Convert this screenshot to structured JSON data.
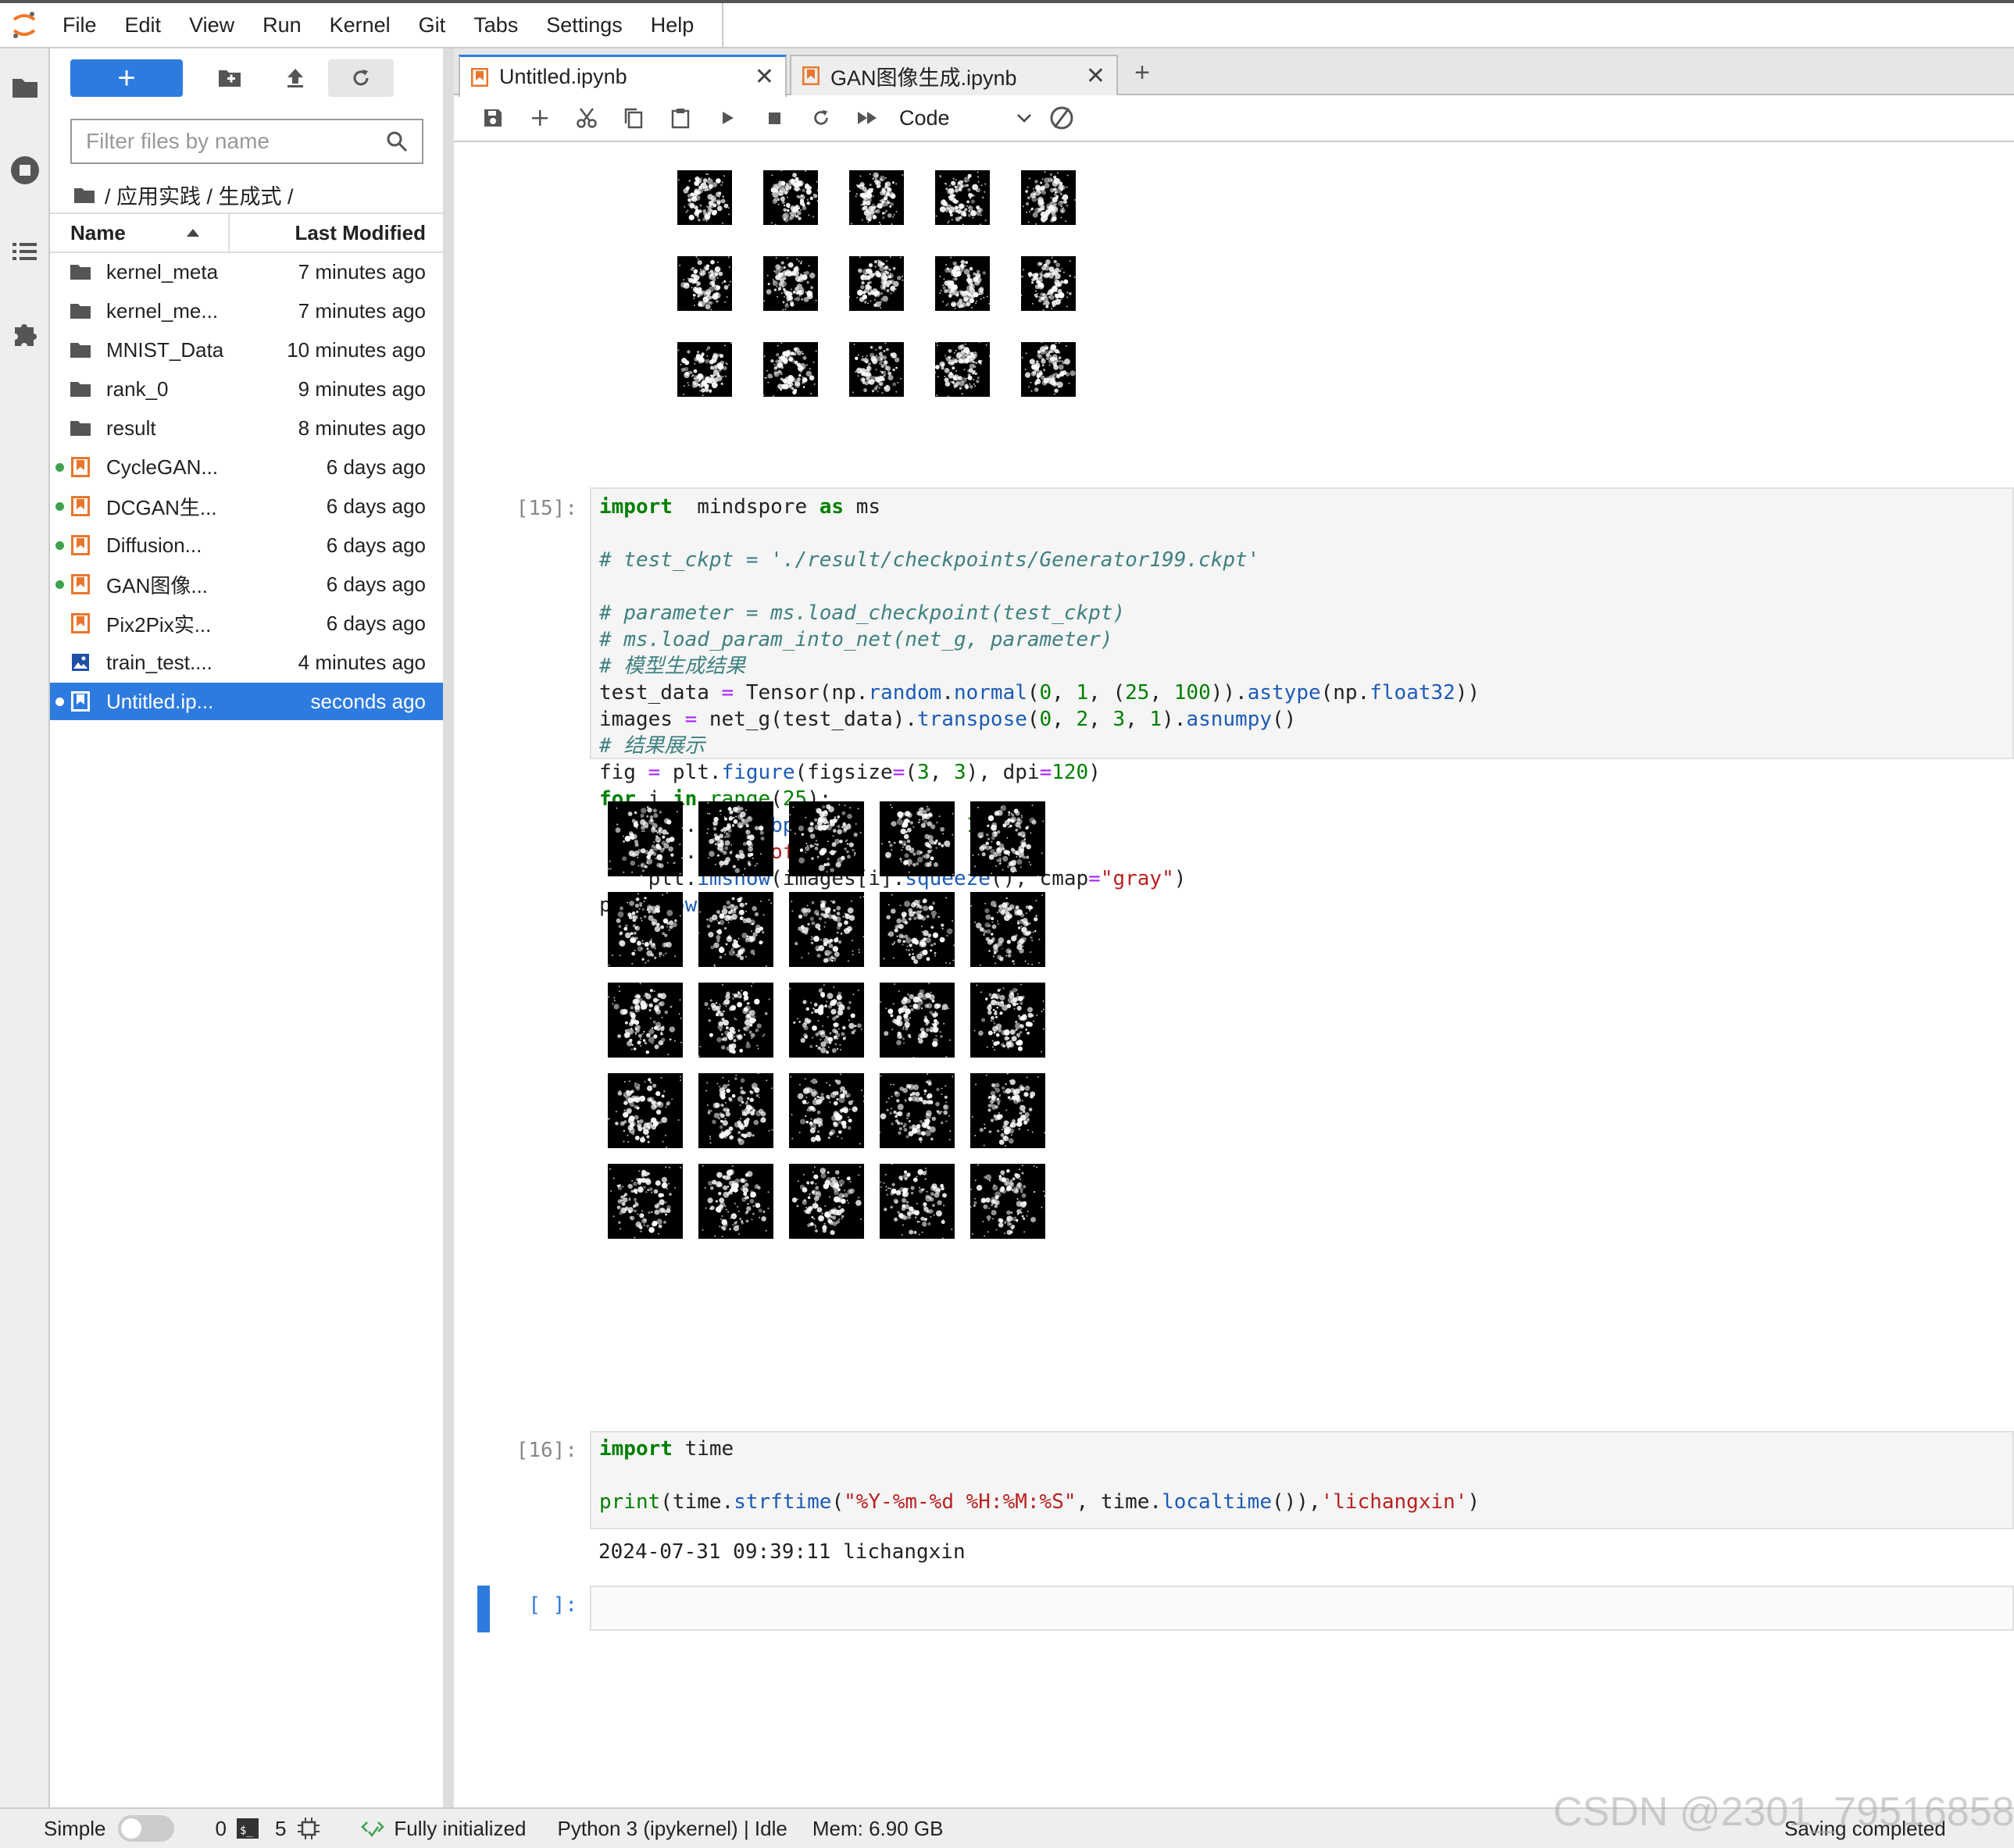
{
  "menu": {
    "items": [
      "File",
      "Edit",
      "View",
      "Run",
      "Kernel",
      "Git",
      "Tabs",
      "Settings",
      "Help"
    ]
  },
  "filebrowser": {
    "filter_placeholder": "Filter files by name",
    "breadcrumb": "/ 应用实践 / 生成式 /",
    "col_name": "Name",
    "col_modified": "Last Modified",
    "files": [
      {
        "name": "kernel_meta",
        "modified": "7 minutes ago",
        "type": "folder",
        "running": false
      },
      {
        "name": "kernel_me...",
        "modified": "7 minutes ago",
        "type": "folder",
        "running": false
      },
      {
        "name": "MNIST_Data",
        "modified": "10 minutes ago",
        "type": "folder",
        "running": false
      },
      {
        "name": "rank_0",
        "modified": "9 minutes ago",
        "type": "folder",
        "running": false
      },
      {
        "name": "result",
        "modified": "8 minutes ago",
        "type": "folder",
        "running": false
      },
      {
        "name": "CycleGAN...",
        "modified": "6 days ago",
        "type": "notebook",
        "running": true
      },
      {
        "name": "DCGAN生...",
        "modified": "6 days ago",
        "type": "notebook",
        "running": true
      },
      {
        "name": "Diffusion...",
        "modified": "6 days ago",
        "type": "notebook",
        "running": true
      },
      {
        "name": "GAN图像...",
        "modified": "6 days ago",
        "type": "notebook",
        "running": true
      },
      {
        "name": "Pix2Pix实...",
        "modified": "6 days ago",
        "type": "notebook",
        "running": false
      },
      {
        "name": "train_test....",
        "modified": "4 minutes ago",
        "type": "image",
        "running": false
      },
      {
        "name": "Untitled.ip...",
        "modified": "seconds ago",
        "type": "notebook",
        "running": true,
        "selected": true
      }
    ]
  },
  "tabs": [
    {
      "label": "Untitled.ipynb",
      "active": true
    },
    {
      "label": "GAN图像生成.ipynb",
      "active": false
    }
  ],
  "toolbar": {
    "cell_type": "Code"
  },
  "cells": {
    "c15": {
      "prompt": "[15]:",
      "lines": [
        [
          [
            "kw",
            "import"
          ],
          [
            "",
            "  mindspore "
          ],
          [
            "kw",
            "as"
          ],
          [
            "",
            " ms"
          ]
        ],
        [
          [
            "",
            ""
          ]
        ],
        [
          [
            "cm",
            "# test_ckpt = './result/checkpoints/Generator199.ckpt'"
          ]
        ],
        [
          [
            "",
            ""
          ]
        ],
        [
          [
            "cm",
            "# parameter = ms.load_checkpoint(test_ckpt)"
          ]
        ],
        [
          [
            "cm",
            "# ms.load_param_into_net(net_g, parameter)"
          ]
        ],
        [
          [
            "cm",
            "# 模型生成结果"
          ]
        ],
        [
          [
            "",
            "test_data "
          ],
          [
            "op",
            "="
          ],
          [
            "",
            " Tensor(np."
          ],
          [
            "fn",
            "random"
          ],
          [
            "",
            "."
          ],
          [
            "fn",
            "normal"
          ],
          [
            "",
            "("
          ],
          [
            "nm",
            "0"
          ],
          [
            "",
            ", "
          ],
          [
            "nm",
            "1"
          ],
          [
            "",
            ", ("
          ],
          [
            "nm",
            "25"
          ],
          [
            "",
            ", "
          ],
          [
            "nm",
            "100"
          ],
          [
            "",
            "))."
          ],
          [
            "fn",
            "astype"
          ],
          [
            "",
            "(np."
          ],
          [
            "fn",
            "float32"
          ],
          [
            "",
            "))"
          ]
        ],
        [
          [
            "",
            "images "
          ],
          [
            "op",
            "="
          ],
          [
            "",
            " net_g(test_data)."
          ],
          [
            "fn",
            "transpose"
          ],
          [
            "",
            "("
          ],
          [
            "nm",
            "0"
          ],
          [
            "",
            ", "
          ],
          [
            "nm",
            "2"
          ],
          [
            "",
            ", "
          ],
          [
            "nm",
            "3"
          ],
          [
            "",
            ", "
          ],
          [
            "nm",
            "1"
          ],
          [
            "",
            ")."
          ],
          [
            "fn",
            "asnumpy"
          ],
          [
            "",
            "()"
          ]
        ],
        [
          [
            "cm",
            "# 结果展示"
          ]
        ],
        [
          [
            "",
            "fig "
          ],
          [
            "op",
            "="
          ],
          [
            "",
            " plt."
          ],
          [
            "fn",
            "figure"
          ],
          [
            "",
            "(figsize"
          ],
          [
            "op",
            "="
          ],
          [
            "",
            "("
          ],
          [
            "nm",
            "3"
          ],
          [
            "",
            ", "
          ],
          [
            "nm",
            "3"
          ],
          [
            "",
            "), dpi"
          ],
          [
            "op",
            "="
          ],
          [
            "nm",
            "120"
          ],
          [
            "",
            ")"
          ]
        ],
        [
          [
            "kw",
            "for"
          ],
          [
            "",
            " i "
          ],
          [
            "kw",
            "in"
          ],
          [
            "",
            " "
          ],
          [
            "nm",
            "range"
          ],
          [
            "",
            "("
          ],
          [
            "nm",
            "25"
          ],
          [
            "",
            "):"
          ]
        ],
        [
          [
            "",
            "    fig."
          ],
          [
            "fn",
            "add_subplot"
          ],
          [
            "",
            "("
          ],
          [
            "nm",
            "5"
          ],
          [
            "",
            ", "
          ],
          [
            "nm",
            "5"
          ],
          [
            "",
            ", i "
          ],
          [
            "op",
            "+"
          ],
          [
            "",
            " "
          ],
          [
            "nm",
            "1"
          ],
          [
            "",
            ")"
          ]
        ],
        [
          [
            "",
            "    plt."
          ],
          [
            "fn",
            "axis"
          ],
          [
            "",
            "("
          ],
          [
            "st",
            "\"off\""
          ],
          [
            "",
            ")"
          ]
        ],
        [
          [
            "",
            "    plt."
          ],
          [
            "fn",
            "imshow"
          ],
          [
            "",
            "(images[i]."
          ],
          [
            "fn",
            "squeeze"
          ],
          [
            "",
            "(), cmap"
          ],
          [
            "op",
            "="
          ],
          [
            "st",
            "\"gray\""
          ],
          [
            "",
            ")"
          ]
        ],
        [
          [
            "",
            "plt."
          ],
          [
            "fn",
            "show"
          ],
          [
            "",
            "()"
          ]
        ]
      ]
    },
    "c16": {
      "prompt": "[16]:",
      "lines": [
        [
          [
            "kw",
            "import"
          ],
          [
            "",
            " time"
          ]
        ],
        [
          [
            "",
            ""
          ]
        ],
        [
          [
            "nm",
            "print"
          ],
          [
            "",
            "(time."
          ],
          [
            "fn",
            "strftime"
          ],
          [
            "",
            "("
          ],
          [
            "st",
            "\"%Y-%m-%d %H:%M:%S\""
          ],
          [
            "",
            ", time."
          ],
          [
            "fn",
            "localtime"
          ],
          [
            "",
            "()),"
          ],
          [
            "st",
            "'lichangxin'"
          ],
          [
            "",
            ")"
          ]
        ]
      ],
      "output": "2024-07-31 09:39:11 lichangxin"
    },
    "empty": {
      "prompt": "[ ]:"
    }
  },
  "status": {
    "mode": "Simple",
    "terminals": "0",
    "kernels": "5",
    "init": "Fully initialized",
    "kernel": "Python 3 (ipykernel) | Idle",
    "mem": "Mem: 6.90 GB",
    "saving": "Saving completed"
  },
  "watermark": "CSDN @2301_79516858",
  "colors": {
    "accent": "#2e7be0",
    "running_dot": "#3ca24b",
    "notebook_icon": "#e8772e"
  }
}
